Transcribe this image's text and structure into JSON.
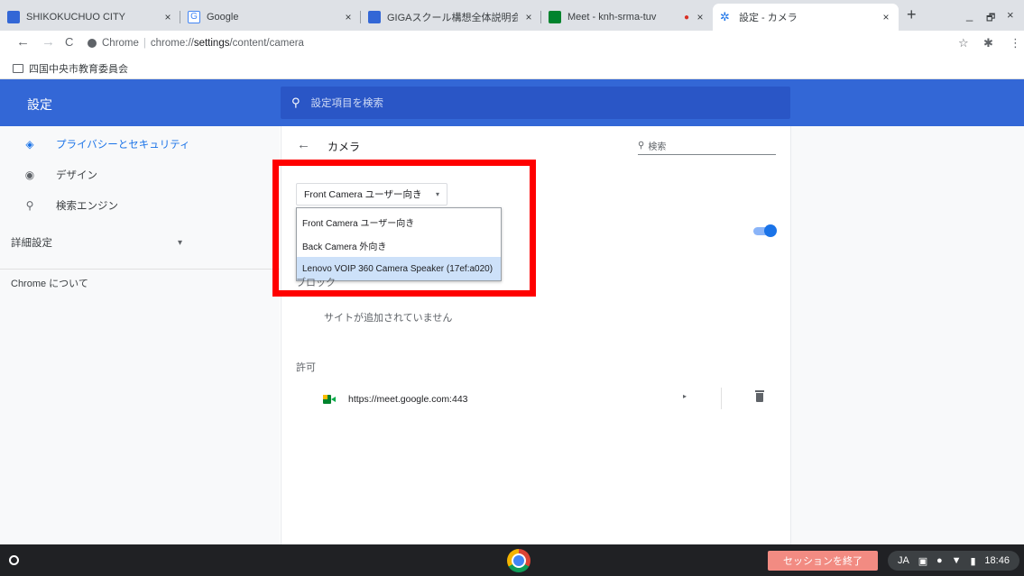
{
  "tabs": [
    {
      "title": "SHIKOKUCHUO CITY",
      "close": "×",
      "favicon_color": "#3367d6"
    },
    {
      "title": "Google",
      "close": "×",
      "favicon_color": "#4285f4"
    },
    {
      "title": "GIGAスクール構想全体説明会",
      "close": "×",
      "favicon_color": "#3367d6"
    },
    {
      "title": "Meet - knh-srma-tuv",
      "close": "×",
      "favicon_color": "#00832d",
      "recording_icon": "●"
    },
    {
      "title": "設定 - カメラ",
      "close": "×",
      "favicon_color": "#1a73e8",
      "active": true
    }
  ],
  "new_tab": "+",
  "window_controls": {
    "minimize": "_",
    "restore": "🗗",
    "close": "×"
  },
  "toolbar": {
    "back": "←",
    "forward": "→",
    "reload": "C",
    "site_chip": "Chrome",
    "url_scheme": "chrome://",
    "url_host": "settings",
    "url_path": "/content/camera",
    "star": "☆",
    "extensions": "✱",
    "menu": "⋮"
  },
  "bookmarks": [
    {
      "label": "四国中央市教育委員会"
    }
  ],
  "settings": {
    "title": "設定",
    "search_placeholder": "設定項目を検索"
  },
  "sidebar": {
    "items": [
      {
        "label": "プライバシーとセキュリティ",
        "icon": "shield-icon",
        "glyph": "◈",
        "active": true
      },
      {
        "label": "デザイン",
        "icon": "palette-icon",
        "glyph": "◉"
      },
      {
        "label": "検索エンジン",
        "icon": "search-icon",
        "glyph": "⚲"
      }
    ],
    "advanced": {
      "label": "詳細設定",
      "caret": "▾"
    },
    "about": "Chrome について"
  },
  "camera_page": {
    "title": "カメラ",
    "back": "←",
    "search_placeholder": "検索",
    "selected_device": "Front Camera ユーザー向き",
    "caret": "▾",
    "options": [
      {
        "label": "Front Camera ユーザー向き"
      },
      {
        "label": "Back Camera 外向き"
      },
      {
        "label": "Lenovo VOIP 360 Camera Speaker (17ef:a020)",
        "highlighted": true
      }
    ],
    "ask_toggle": true,
    "block_label": "ブロック",
    "block_empty": "サイトが追加されていません",
    "allow_label": "許可",
    "allowed_sites": [
      {
        "url": "https://meet.google.com:443",
        "arrow": "▸"
      }
    ]
  },
  "shelf": {
    "end_session": "セッションを終了",
    "ime": "JA",
    "time": "18:46"
  },
  "colors": {
    "header_blue": "#3367d6",
    "highlight_red": "#ff0000",
    "toggle_blue": "#1a73e8",
    "end_session_bg": "#f28b82"
  }
}
